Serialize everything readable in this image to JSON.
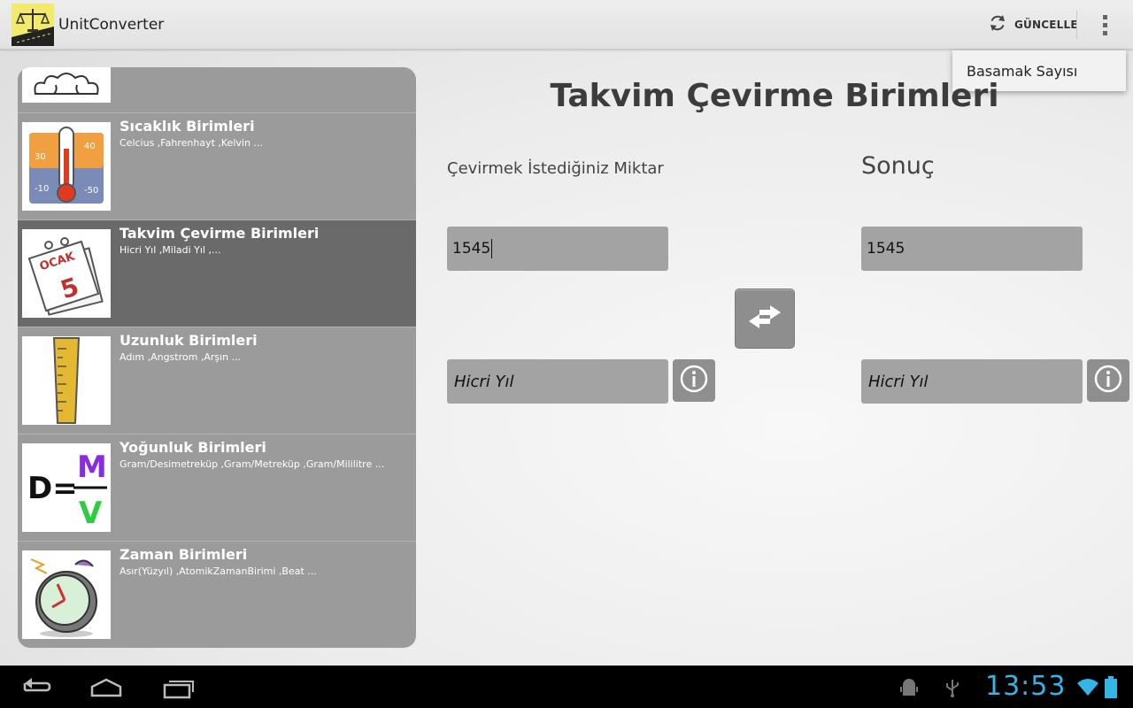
{
  "actionbar": {
    "app_title": "UnitConverter",
    "refresh_label": "GÜNCELLE"
  },
  "menu": {
    "items": [
      {
        "label": "Basamak Sayısı"
      }
    ]
  },
  "list": {
    "items": [
      {
        "title": "Sıcaklık Birimleri",
        "subtitle": "Celcius ,Fahrenhayt ,Kelvin ...",
        "icon": "thermometer-icon"
      },
      {
        "title": "Takvim Çevirme Birimleri",
        "subtitle": "Hicri Yıl ,Miladi Yıl ,...",
        "icon": "calendar-icon"
      },
      {
        "title": "Uzunluk Birimleri",
        "subtitle": "Adım ,Angstrom ,Arşın ...",
        "icon": "ruler-icon"
      },
      {
        "title": "Yoğunluk Birimleri",
        "subtitle": "Gram/Desimetreküp ,Gram/Metreküp ,Gram/Mililitre ...",
        "icon": "density-formula-icon"
      },
      {
        "title": "Zaman Birimleri",
        "subtitle": "Asır(Yüzyıl) ,AtomikZamanBirimi ,Beat ...",
        "icon": "alarm-clock-icon"
      }
    ],
    "selected_index": 1
  },
  "main": {
    "title": "Takvim Çevirme Birimleri",
    "input_label": "Çevirmek İstediğiniz Miktar",
    "result_label": "Sonuç",
    "input_value": "1545",
    "result_value": "1545",
    "from_unit": "Hicri Yıl",
    "to_unit": "Hicri Yıl"
  },
  "system": {
    "clock": "13:53"
  },
  "colors": {
    "accent": "#33b5e5",
    "list_bg": "#9b9b9b",
    "list_selected": "#6a6a6a",
    "field_bg": "#a3a3a3"
  }
}
